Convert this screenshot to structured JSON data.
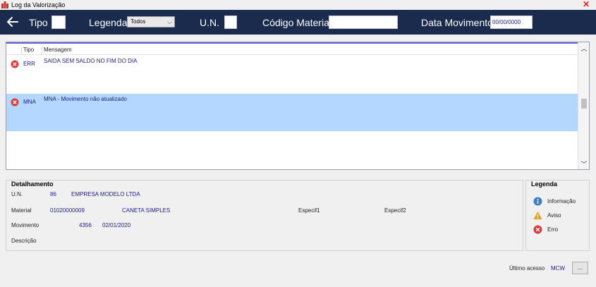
{
  "window": {
    "title": "Log da Valorização"
  },
  "toolbar": {
    "tipo_label": "Tipo",
    "tipo_value": "",
    "legenda_label": "Legenda",
    "legenda_selected": "Todos",
    "un_label": "U.N.",
    "un_value": "",
    "codigo_label": "Código Material",
    "codigo_value": "",
    "data_label": "Data Movimento",
    "data_value": "00/00/0000"
  },
  "grid": {
    "columns": [
      "Tipo",
      "Mensagem"
    ],
    "rows": [
      {
        "tipo": "ERR",
        "mensagem": "SAIDA SEM SALDO NO FIM DO DIA",
        "icon": "error-icon",
        "selected": false
      },
      {
        "tipo": "MNA",
        "mensagem": "MNA - Movimento não atualizado",
        "icon": "error-icon",
        "selected": true
      }
    ]
  },
  "detail": {
    "title": "Detalhamento",
    "un_label": "U.N.",
    "un_code": "86",
    "un_name": "EMPRESA MODELO LTDA",
    "material_label": "Material",
    "material_code": "01020000009",
    "material_name": "CANETA SIMPLES",
    "especif1_label": "Especif1",
    "especif2_label": "Especif2",
    "movimento_label": "Movimento",
    "movimento_num": "4356",
    "movimento_date": "02/01/2020",
    "descricao_label": "Descrição"
  },
  "legend": {
    "title": "Legenda",
    "items": [
      {
        "label": "Informação",
        "icon": "info-icon",
        "color": "#3d7fc1"
      },
      {
        "label": "Aviso",
        "icon": "warning-icon",
        "color": "#e0a01c"
      },
      {
        "label": "Erro",
        "icon": "error-icon",
        "color": "#d93a3a"
      }
    ]
  },
  "footer": {
    "ultimo_acesso_label": "Último acesso",
    "ultimo_acesso_value": "MCW",
    "more_label": "..."
  },
  "colors": {
    "toolbar_bg": "#1a2b4e",
    "selected_row": "#b3d7ff",
    "value_text": "#1a1a8c"
  }
}
